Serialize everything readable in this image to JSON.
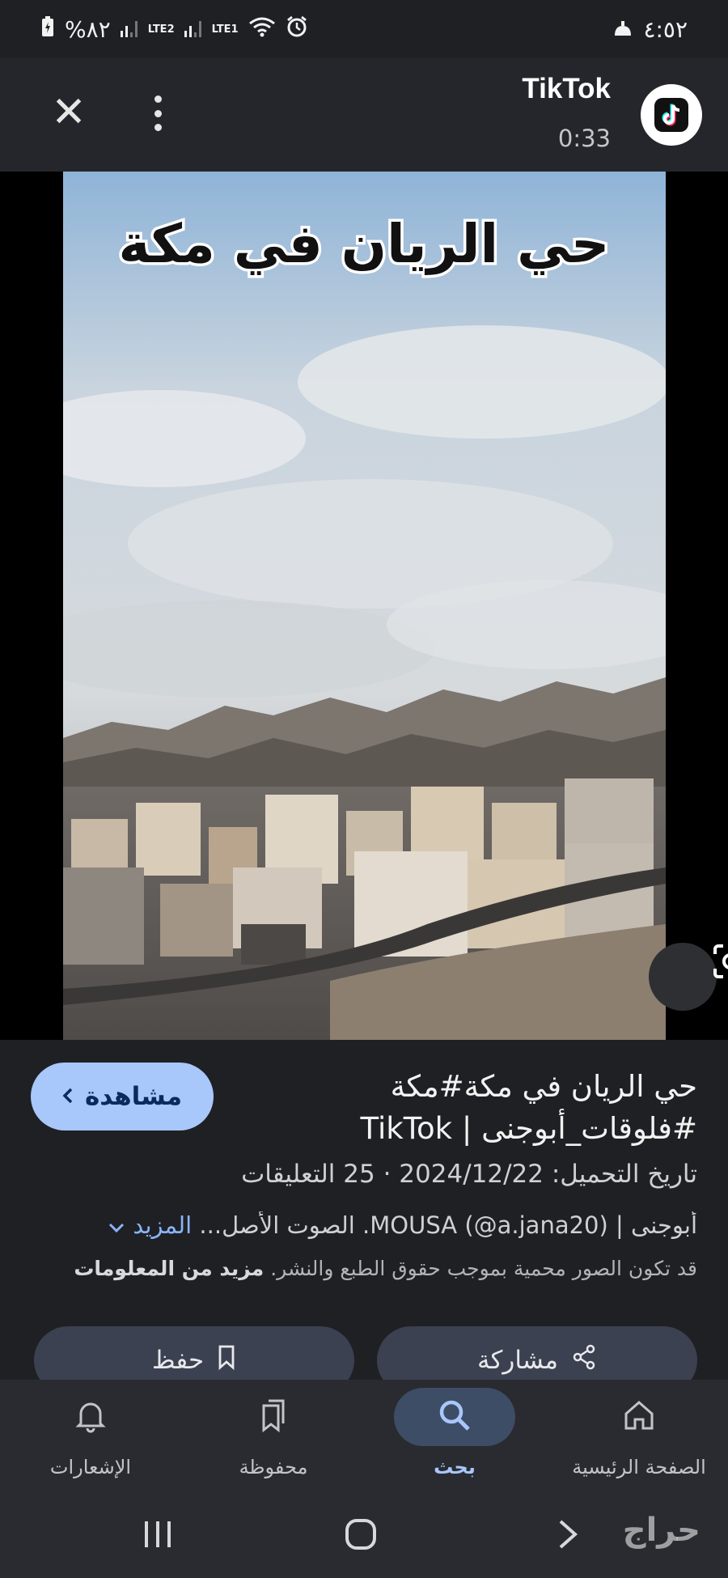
{
  "status_bar": {
    "time": "٤:٥٢",
    "battery": "%٨٢",
    "sim1": "LTE1",
    "sim2": "LTE2"
  },
  "header": {
    "app_name": "TikTok",
    "duration": "0:33"
  },
  "image": {
    "overlay_text": "حي الريان في مكة"
  },
  "result": {
    "watch_label": "مشاهدة",
    "title_line1": "حي الريان في مكة#مكة",
    "title_line2": "#فلوقات_أبوجنى | TikTok",
    "upload_line": "تاريخ التحميل: 2024/12/22 · 25 التعليقات",
    "source_text": "أبوجنى | (MOUSA (@a.jana20. الصوت الأصل...",
    "more_label": "المزيد",
    "copyright_text": "قد تكون الصور محمية بموجب حقوق الطبع والنشر.",
    "more_info_label": "مزيد من المعلومات",
    "share_label": "مشاركة",
    "save_label": "حفظ"
  },
  "bottom_nav": {
    "items": [
      {
        "label": "الصفحة الرئيسية",
        "icon": "home-icon"
      },
      {
        "label": "بحث",
        "icon": "search-icon",
        "active": true
      },
      {
        "label": "محفوظة",
        "icon": "bookmarks-icon"
      },
      {
        "label": "الإشعارات",
        "icon": "bell-icon"
      }
    ]
  },
  "watermark": "حراج",
  "colors": {
    "background": "#1f2024",
    "accent": "#a8c7fa",
    "link": "#8ab4f8",
    "button": "#3b4150"
  }
}
